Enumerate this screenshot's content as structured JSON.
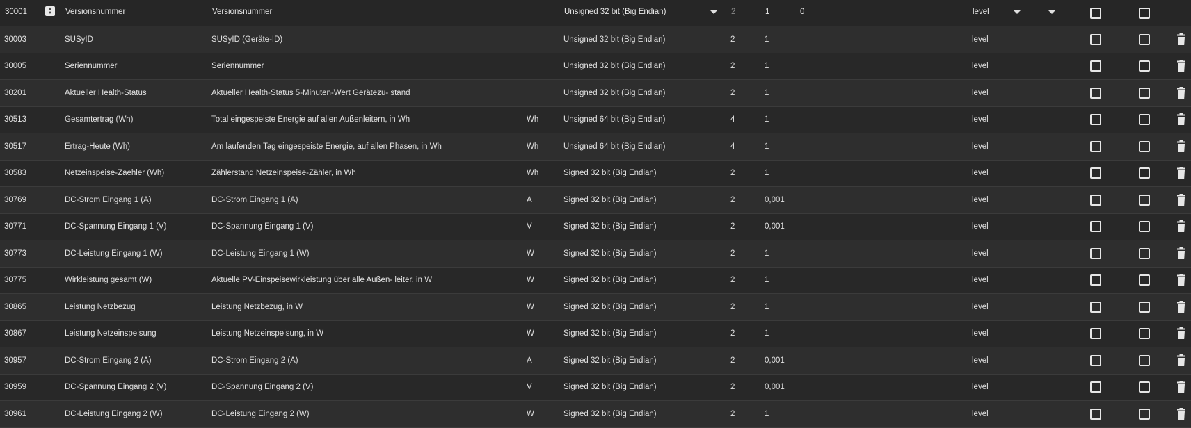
{
  "edit_row": {
    "address": "30001",
    "name": "Versionsnummer",
    "description": "Versionsnummer",
    "unit": "",
    "type": "Unsigned 32 bit (Big Endian)",
    "length": "2",
    "factor": "1",
    "offset": "0",
    "extra": "",
    "role": "level",
    "role2": ""
  },
  "rows": [
    {
      "address": "30003",
      "name": "SUSyID",
      "description": "SUSyID (Geräte-ID)",
      "unit": "",
      "type": "Unsigned 32 bit (Big Endian)",
      "length": "2",
      "factor": "1",
      "role": "level"
    },
    {
      "address": "30005",
      "name": "Seriennummer",
      "description": "Seriennummer",
      "unit": "",
      "type": "Unsigned 32 bit (Big Endian)",
      "length": "2",
      "factor": "1",
      "role": "level"
    },
    {
      "address": "30201",
      "name": "Aktueller Health-Status",
      "description": "Aktueller Health-Status 5-Minuten-Wert Gerätezu- stand",
      "unit": "",
      "type": "Unsigned 32 bit (Big Endian)",
      "length": "2",
      "factor": "1",
      "role": "level"
    },
    {
      "address": "30513",
      "name": "Gesamtertrag (Wh)",
      "description": "Total eingespeiste Energie auf allen Außenleitern, in Wh",
      "unit": "Wh",
      "type": "Unsigned 64 bit (Big Endian)",
      "length": "4",
      "factor": "1",
      "role": "level"
    },
    {
      "address": "30517",
      "name": "Ertrag-Heute (Wh)",
      "description": "Am laufenden Tag eingespeiste Energie, auf allen Phasen, in Wh",
      "unit": "Wh",
      "type": "Unsigned 64 bit (Big Endian)",
      "length": "4",
      "factor": "1",
      "role": "level"
    },
    {
      "address": "30583",
      "name": "Netzeinspeise-Zaehler (Wh)",
      "description": "Zählerstand Netzeinspeise-Zähler, in Wh",
      "unit": "Wh",
      "type": "Signed 32 bit (Big Endian)",
      "length": "2",
      "factor": "1",
      "role": "level"
    },
    {
      "address": "30769",
      "name": "DC-Strom Eingang 1 (A)",
      "description": "DC-Strom Eingang 1 (A)",
      "unit": "A",
      "type": "Signed 32 bit (Big Endian)",
      "length": "2",
      "factor": "0,001",
      "role": "level"
    },
    {
      "address": "30771",
      "name": "DC-Spannung Eingang 1 (V)",
      "description": "DC-Spannung Eingang 1 (V)",
      "unit": "V",
      "type": "Signed 32 bit (Big Endian)",
      "length": "2",
      "factor": "0,001",
      "role": "level"
    },
    {
      "address": "30773",
      "name": "DC-Leistung Eingang 1 (W)",
      "description": "DC-Leistung Eingang 1 (W)",
      "unit": "W",
      "type": "Signed 32 bit (Big Endian)",
      "length": "2",
      "factor": "1",
      "role": "level"
    },
    {
      "address": "30775",
      "name": "Wirkleistung gesamt (W)",
      "description": "Aktuelle PV-Einspeisewirkleistung über alle Außen- leiter, in W",
      "unit": "W",
      "type": "Signed 32 bit (Big Endian)",
      "length": "2",
      "factor": "1",
      "role": "level"
    },
    {
      "address": "30865",
      "name": "Leistung Netzbezug",
      "description": "Leistung Netzbezug, in W",
      "unit": "W",
      "type": "Signed 32 bit (Big Endian)",
      "length": "2",
      "factor": "1",
      "role": "level"
    },
    {
      "address": "30867",
      "name": "Leistung Netzeinspeisung",
      "description": "Leistung Netzeinspeisung, in W",
      "unit": "W",
      "type": "Signed 32 bit (Big Endian)",
      "length": "2",
      "factor": "1",
      "role": "level"
    },
    {
      "address": "30957",
      "name": "DC-Strom Eingang 2 (A)",
      "description": "DC-Strom Eingang 2 (A)",
      "unit": "A",
      "type": "Signed 32 bit (Big Endian)",
      "length": "2",
      "factor": "0,001",
      "role": "level"
    },
    {
      "address": "30959",
      "name": "DC-Spannung Eingang 2 (V)",
      "description": "DC-Spannung Eingang 2 (V)",
      "unit": "V",
      "type": "Signed 32 bit (Big Endian)",
      "length": "2",
      "factor": "0,001",
      "role": "level"
    },
    {
      "address": "30961",
      "name": "DC-Leistung Eingang 2 (W)",
      "description": "DC-Leistung Eingang 2 (W)",
      "unit": "W",
      "type": "Signed 32 bit (Big Endian)",
      "length": "2",
      "factor": "1",
      "role": "level"
    }
  ],
  "icons": {
    "checkbox": "checkbox-icon",
    "delete": "trash-icon",
    "dropdown": "chevron-down-icon"
  },
  "colors": {
    "background": "#2b2b2b",
    "text": "#e0e0e0"
  }
}
